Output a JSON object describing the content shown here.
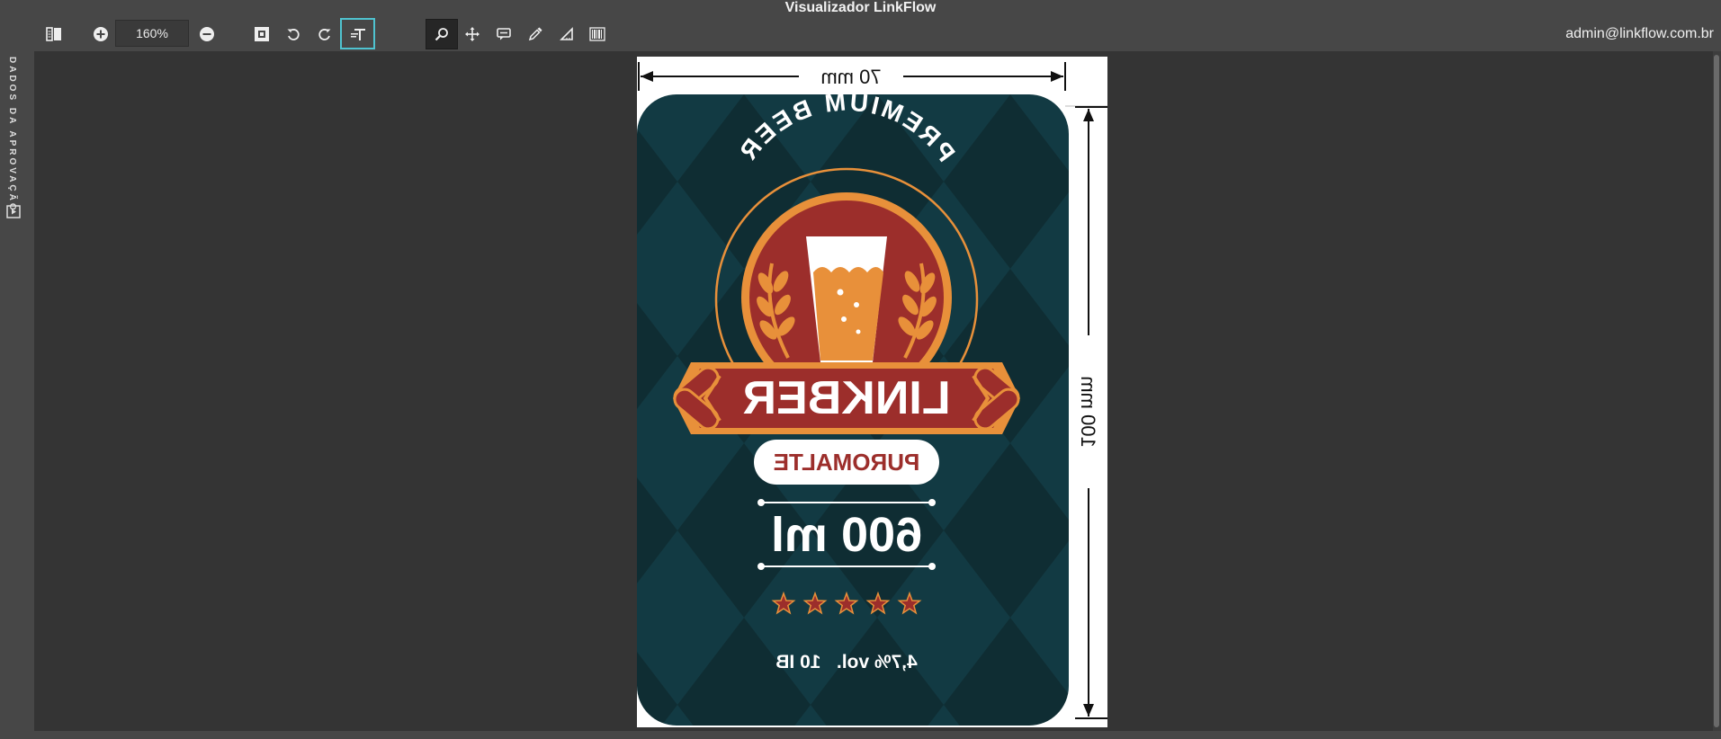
{
  "app": {
    "title": "Visualizador LinkFlow"
  },
  "toolbar": {
    "zoom_value": "160%"
  },
  "user": {
    "email": "admin@linkflow.com.br"
  },
  "side_panel": {
    "label": "DADOS DA APROVAÇÃO"
  },
  "artwork": {
    "width_dimension": "70 mm",
    "height_dimension": "100 mm",
    "arc_text": "PREMIUM BEER",
    "brand": "LINKBER",
    "sub_brand": "PUROMALTE",
    "volume": "600 ml",
    "rating": 5,
    "details": "4,7% vol.   10 IB",
    "colors": {
      "background": "#123a43",
      "diamond_dark": "#0f2d33",
      "red": "#9c2e2b",
      "orange": "#e8903a",
      "cream": "#ffffff"
    }
  },
  "icons": [
    "panel-toggle-icon",
    "zoom-in-icon",
    "zoom-out-icon",
    "fit-screen-icon",
    "rotate-left-icon",
    "rotate-right-icon",
    "text-layer-icon",
    "magnifier-icon",
    "move-icon",
    "comment-icon",
    "eyedropper-icon",
    "ruler-icon",
    "barcode-icon",
    "sidebar-expand-icon"
  ]
}
